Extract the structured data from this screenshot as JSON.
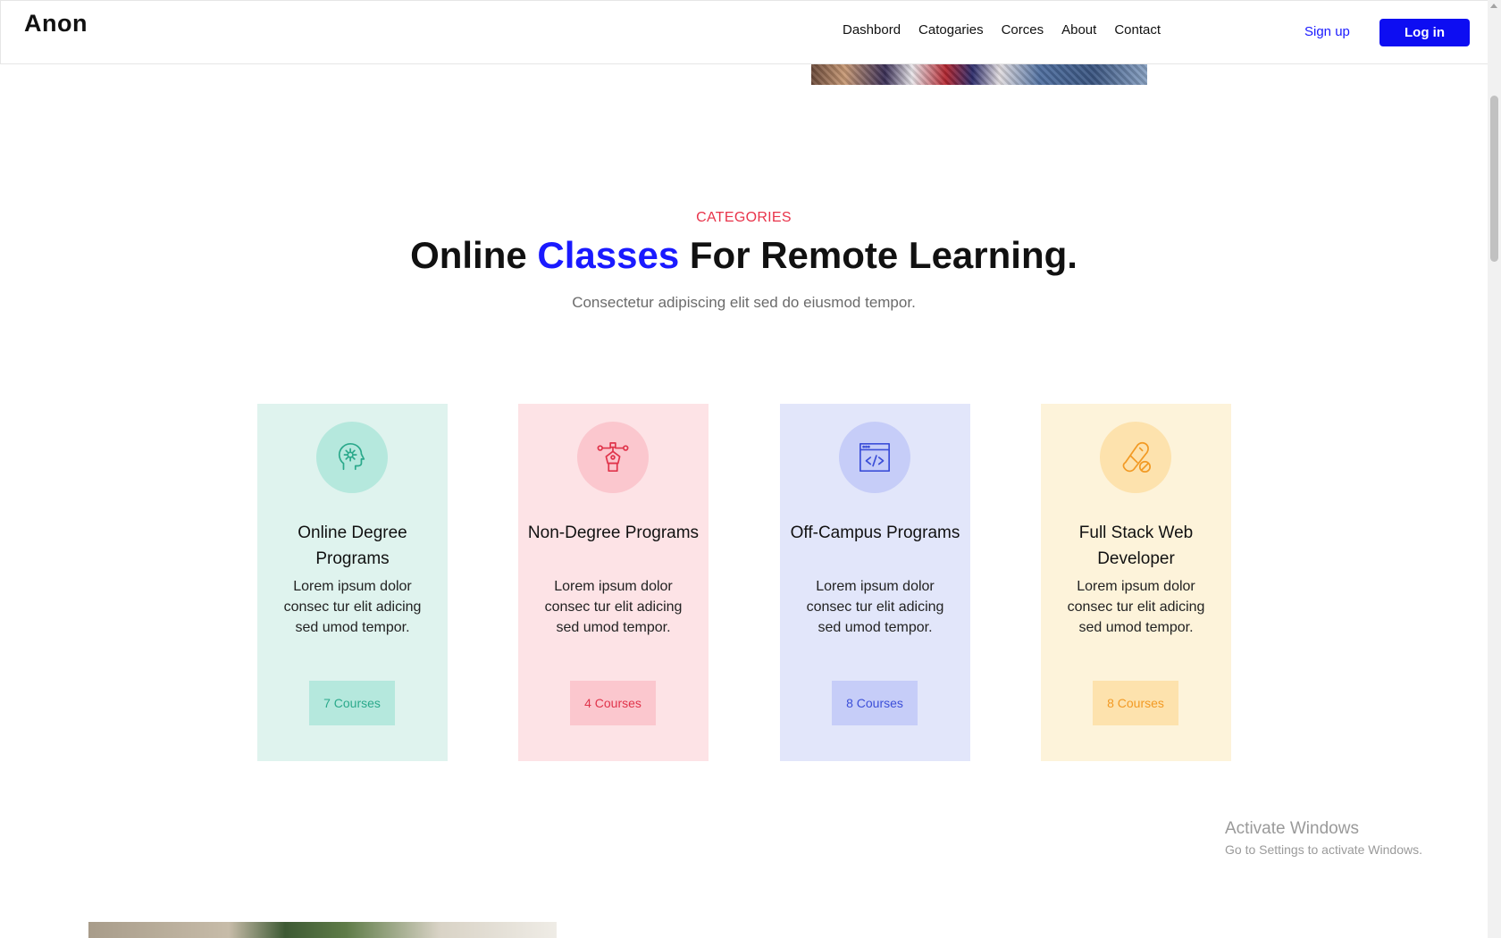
{
  "header": {
    "logo": "Anon",
    "nav": [
      "Dashbord",
      "Catogaries",
      "Corces",
      "About",
      "Contact"
    ],
    "signup_label": "Sign up",
    "login_label": "Log in"
  },
  "section": {
    "eyebrow": "CATEGORIES",
    "title_before": "Online ",
    "title_highlight": "Classes",
    "title_after": " For Remote Learning.",
    "subtitle": "Consectetur adipiscing elit sed do eiusmod tempor."
  },
  "cards": [
    {
      "icon": "mind-gear-icon",
      "title": "Online Degree Programs",
      "description": "Lorem ipsum dolor consec tur elit adicing sed umod tempor.",
      "courses": "7 Courses",
      "accent": "#2ba98b"
    },
    {
      "icon": "pen-tool-icon",
      "title": "Non-Degree Programs",
      "description": "Lorem ipsum dolor consec tur elit adicing sed umod tempor.",
      "courses": "4 Courses",
      "accent": "#e0344b"
    },
    {
      "icon": "code-window-icon",
      "title": "Off-Campus Programs",
      "description": "Lorem ipsum dolor consec tur elit adicing sed umod tempor.",
      "courses": "8 Courses",
      "accent": "#3c4fd8"
    },
    {
      "icon": "pill-icon",
      "title": "Full Stack Web Developer",
      "description": "Lorem ipsum dolor consec tur elit adicing sed umod tempor.",
      "courses": "8 Courses",
      "accent": "#f29a24"
    }
  ],
  "watermark": {
    "title": "Activate Windows",
    "subtitle": "Go to Settings to activate Windows."
  },
  "colors": {
    "brand_blue": "#0d0df2",
    "category_red": "#e8334a"
  }
}
